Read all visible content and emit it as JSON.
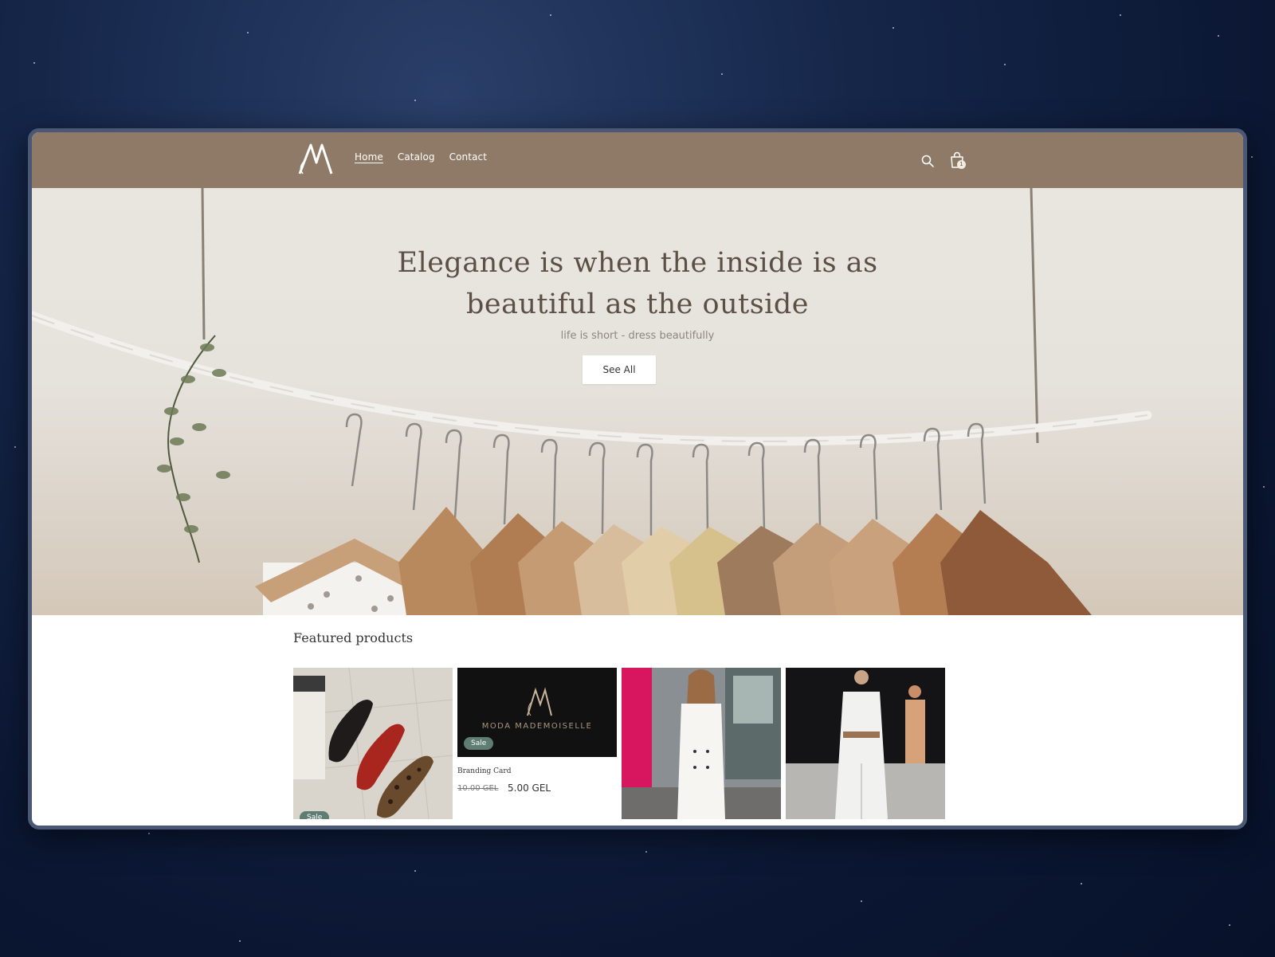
{
  "nav": {
    "items": [
      {
        "label": "Home",
        "active": true
      },
      {
        "label": "Catalog",
        "active": false
      },
      {
        "label": "Contact",
        "active": false
      }
    ]
  },
  "header": {
    "search_icon": "search-icon",
    "cart_icon": "cart-icon",
    "cart_count": "1"
  },
  "hero": {
    "title": "Elegance is when the inside is as beautiful as the outside",
    "subtitle": "life is short - dress beautifully",
    "button": "See All"
  },
  "featured": {
    "title": "Featured products",
    "products": [
      {
        "badge": "Sale"
      },
      {
        "brand": "MODA MADEMOISELLE",
        "badge": "Sale",
        "name": "Branding Card",
        "old_price": "10.00 GEL",
        "price": "5.00 GEL"
      },
      {},
      {}
    ]
  },
  "colors": {
    "header_bg": "#8e7a66",
    "sale_badge": "#5f7d73",
    "page_bg": "#0b1733"
  }
}
